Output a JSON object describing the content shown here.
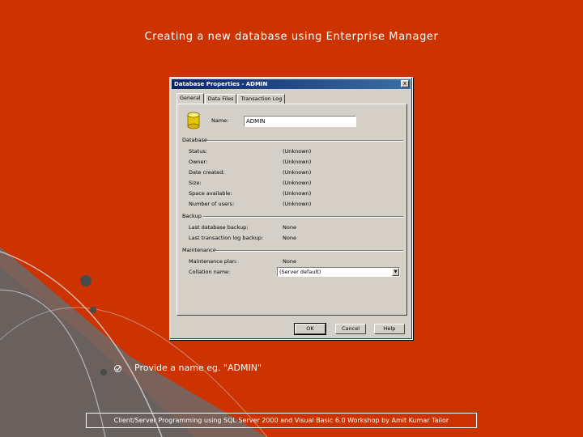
{
  "colors": {
    "slide_background": "#cc3300",
    "dialog_face": "#d4d0c8",
    "titlebar": "#0a246a",
    "decor_gray": "#6b6b6b"
  },
  "slide": {
    "title": "Creating a new database using Enterprise Manager",
    "bullet_icon": "bullet-glyph-icon",
    "bullet_text": "Provide a name eg. \"ADMIN\"",
    "footer": "Client/Server Programming using SQL Server 2000 and Visual Basic 6.0 Workshop by Amit Kumar Tailor"
  },
  "dialog": {
    "title": "Database Properties - ADMIN",
    "close_label": "x",
    "tabs": [
      {
        "label": "General",
        "active": true
      },
      {
        "label": "Data Files",
        "active": false
      },
      {
        "label": "Transaction Log",
        "active": false
      }
    ],
    "name_label": "Name:",
    "name_value": "ADMIN",
    "database_icon": "database-icon",
    "sections": {
      "database": {
        "heading": "Database",
        "rows": [
          {
            "label": "Status:",
            "value": "(Unknown)"
          },
          {
            "label": "Owner:",
            "value": "(Unknown)"
          },
          {
            "label": "Date created:",
            "value": "(Unknown)"
          },
          {
            "label": "Size:",
            "value": "(Unknown)"
          },
          {
            "label": "Space available:",
            "value": "(Unknown)"
          },
          {
            "label": "Number of users:",
            "value": "(Unknown)"
          }
        ]
      },
      "backup": {
        "heading": "Backup",
        "rows": [
          {
            "label": "Last database backup:",
            "value": "None"
          },
          {
            "label": "Last transaction log backup:",
            "value": "None"
          }
        ]
      },
      "maintenance": {
        "heading": "Maintenance",
        "rows": [
          {
            "label": "Maintenance plan:",
            "value": "None"
          },
          {
            "label": "Collation name:",
            "value": "(Server default)"
          }
        ]
      }
    },
    "buttons": {
      "ok": "OK",
      "cancel": "Cancel",
      "help": "Help"
    }
  }
}
